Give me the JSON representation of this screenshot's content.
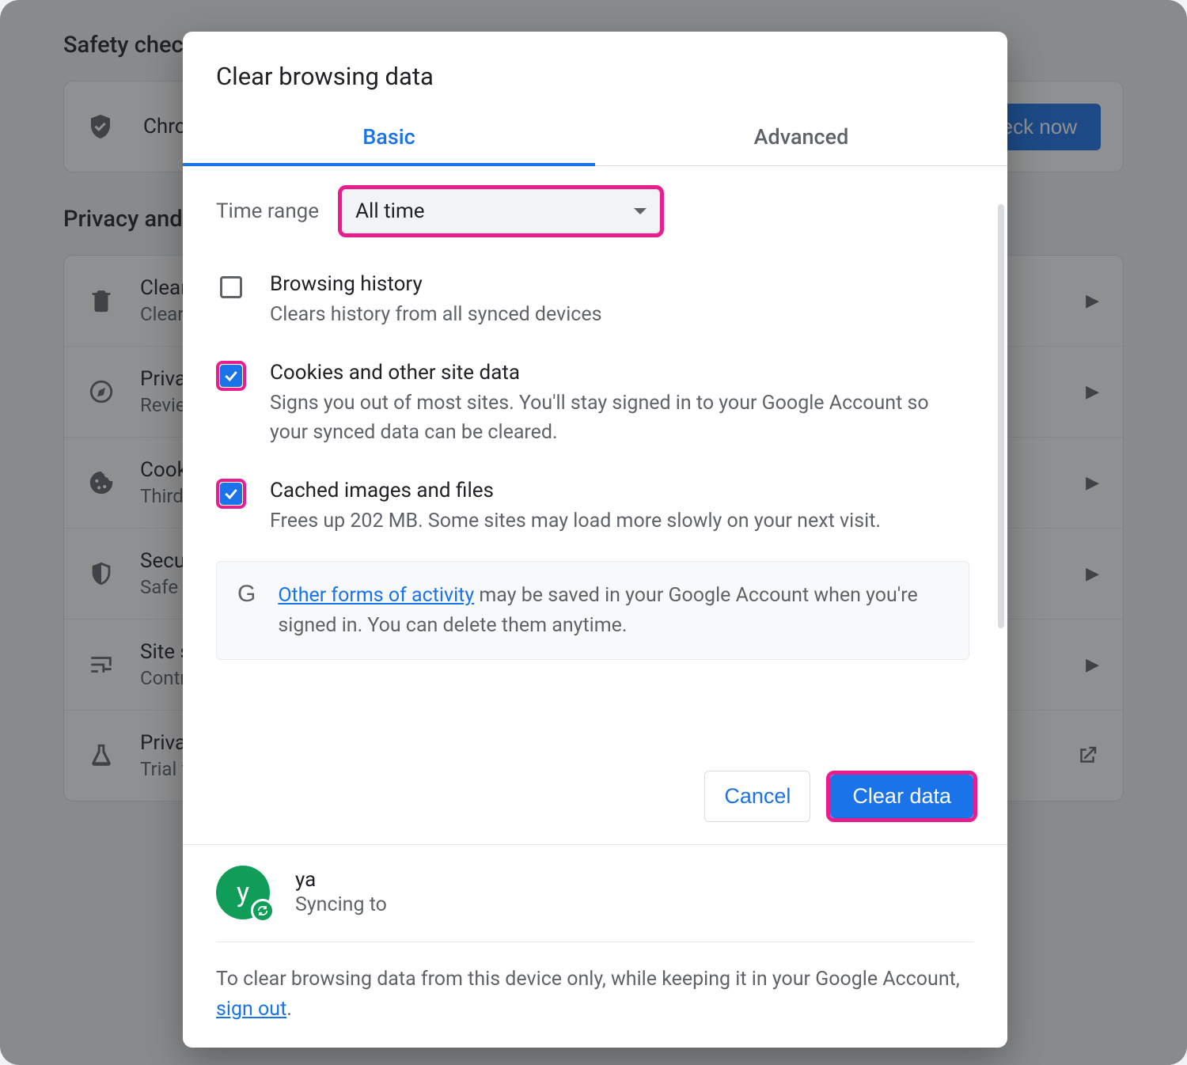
{
  "background": {
    "safety_heading": "Safety check",
    "safety_text": "Chrome can help keep you safe from data breaches, bad extensions, and more",
    "check_now": "Check now",
    "privacy_heading": "Privacy and security",
    "rows": [
      {
        "title": "Clear browsing data",
        "sub": "Clear history, cookies, cache, and more"
      },
      {
        "title": "Privacy Guide",
        "sub": "Review key privacy and security controls"
      },
      {
        "title": "Cookies and other site data",
        "sub": "Third-party cookies are blocked in Incognito mode"
      },
      {
        "title": "Security",
        "sub": "Safe Browsing (protection from dangerous sites) and other security settings"
      },
      {
        "title": "Site settings",
        "sub": "Controls what information sites can use and show"
      },
      {
        "title": "Privacy Sandbox",
        "sub": "Trial features are on"
      }
    ]
  },
  "dialog": {
    "title": "Clear browsing data",
    "tabs": {
      "basic": "Basic",
      "advanced": "Advanced"
    },
    "time_label": "Time range",
    "time_value": "All time",
    "options": [
      {
        "checked": false,
        "highlight": false,
        "title": "Browsing history",
        "sub": "Clears history from all synced devices"
      },
      {
        "checked": true,
        "highlight": true,
        "title": "Cookies and other site data",
        "sub": "Signs you out of most sites. You'll stay signed in to your Google Account so your synced data can be cleared."
      },
      {
        "checked": true,
        "highlight": true,
        "title": "Cached images and files",
        "sub": "Frees up 202 MB. Some sites may load more slowly on your next visit."
      }
    ],
    "info_link": "Other forms of activity",
    "info_rest": " may be saved in your Google Account when you're signed in. You can delete them anytime.",
    "cancel": "Cancel",
    "clear": "Clear data",
    "sync": {
      "avatar_letter": "y",
      "name": "ya",
      "sub": "Syncing to"
    },
    "footer_pre": "To clear browsing data from this device only, while keeping it in your Google Account, ",
    "footer_link": "sign out",
    "footer_post": "."
  }
}
